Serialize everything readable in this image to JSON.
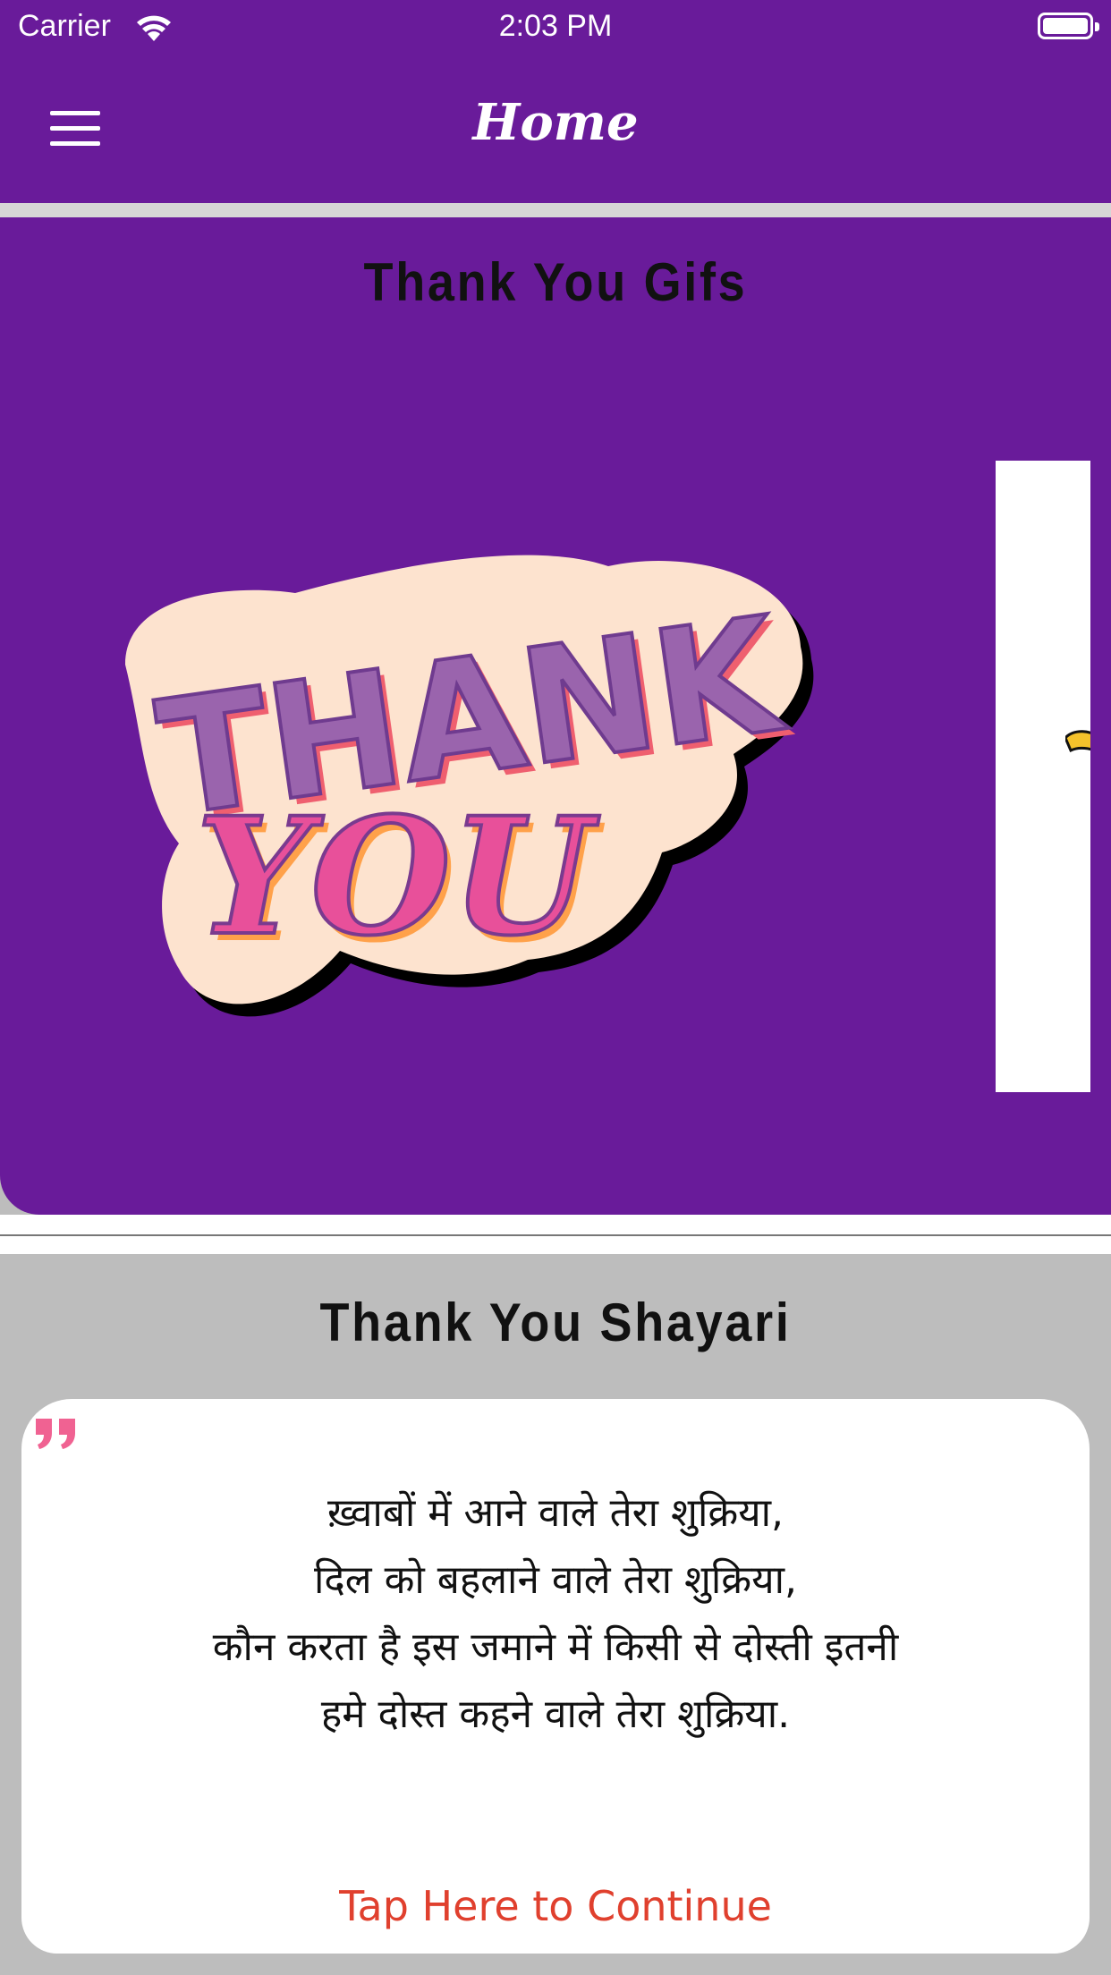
{
  "status_bar": {
    "carrier": "Carrier",
    "time": "2:03 PM"
  },
  "nav": {
    "title": "Home",
    "menu_icon": "hamburger-menu-icon"
  },
  "gifs": {
    "title": "Thank You Gifs",
    "sticker_text_top": "THANK",
    "sticker_text_bottom": "YOU"
  },
  "shayari": {
    "title": "Thank You Shayari",
    "quote_icon": "quote-icon",
    "lines": [
      "ख़्वाबों में आने वाले तेरा शुक्रिया,",
      "दिल को बहलाने वाले तेरा शुक्रिया,",
      "कौन करता है इस जमाने में किसी से दोस्ती इतनी",
      "हमे दोस्त कहने वाले तेरा शुक्रिया."
    ],
    "continue_label": "Tap Here to Continue"
  },
  "colors": {
    "primary": "#691b9a",
    "accent": "#e0402e",
    "quote": "#f06292",
    "background": "#bdbdbd"
  }
}
